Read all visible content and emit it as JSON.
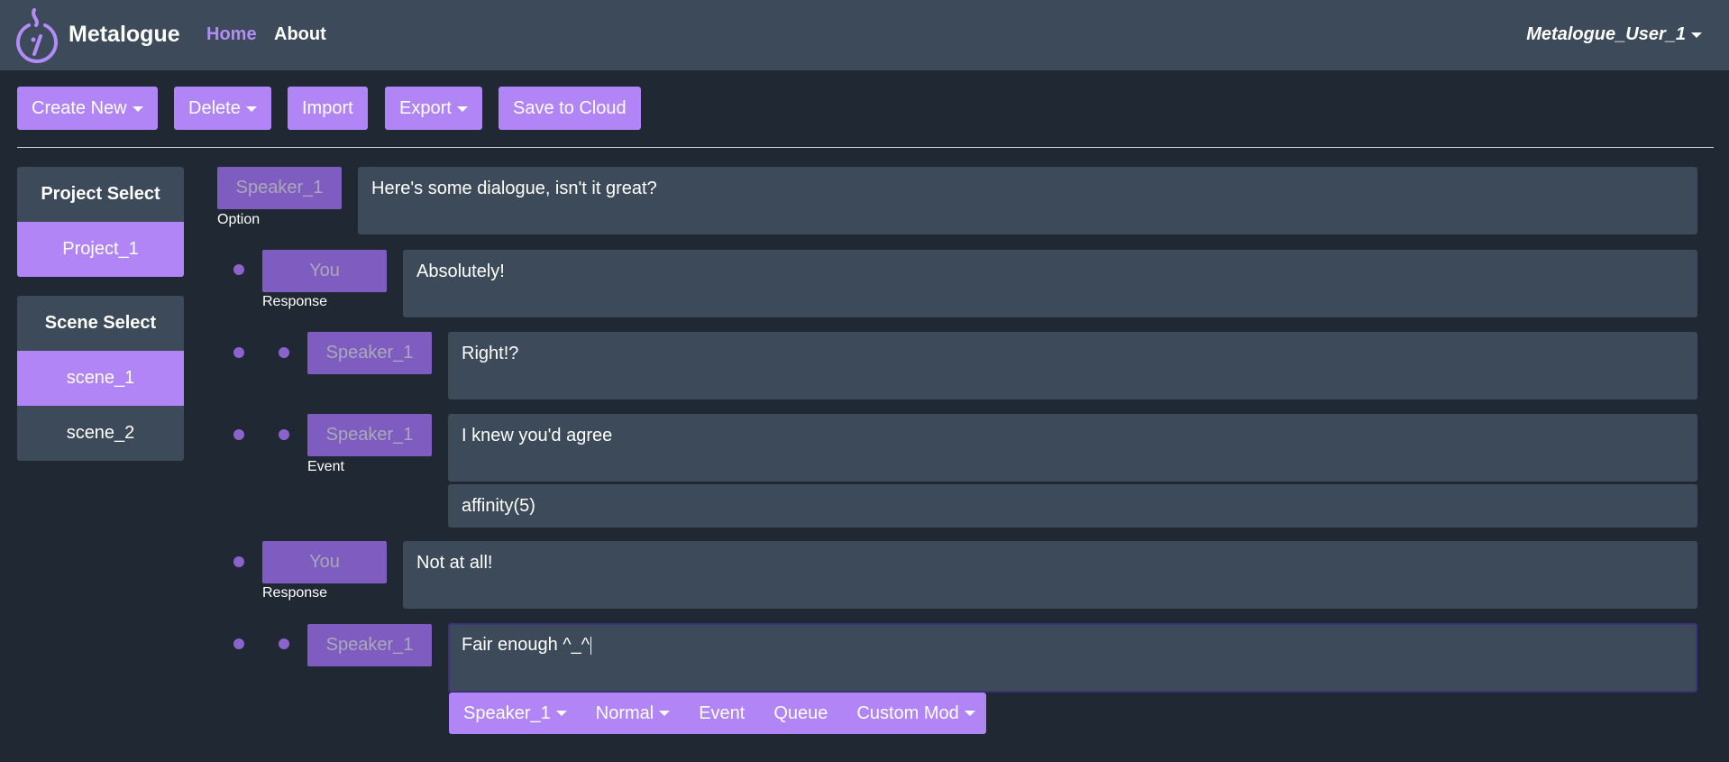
{
  "app": {
    "name": "Metalogue"
  },
  "nav": {
    "home": "Home",
    "about": "About",
    "user": "Metalogue_User_1"
  },
  "toolbar": {
    "create_new": "Create New",
    "delete": "Delete",
    "import": "Import",
    "export": "Export",
    "save_cloud": "Save to Cloud"
  },
  "sidebar": {
    "project_header": "Project Select",
    "projects": [
      "Project_1"
    ],
    "scene_header": "Scene Select",
    "scenes": [
      "scene_1",
      "scene_2"
    ]
  },
  "dialogue": [
    {
      "speaker": "Speaker_1",
      "role": "Option",
      "text": "Here's some dialogue, isn't it great?"
    },
    {
      "speaker": "You",
      "role": "Response",
      "text": "Absolutely!"
    },
    {
      "speaker": "Speaker_1",
      "role": "",
      "text": "Right!?"
    },
    {
      "speaker": "Speaker_1",
      "role": "Event",
      "text": "I knew you'd agree",
      "event": "affinity(5)"
    },
    {
      "speaker": "You",
      "role": "Response",
      "text": "Not at all!"
    },
    {
      "speaker": "Speaker_1",
      "role": "",
      "text": "Fair enough ^_^"
    }
  ],
  "editor_bar": {
    "speaker": "Speaker_1",
    "mode": "Normal",
    "event": "Event",
    "queue": "Queue",
    "custom_mod": "Custom Mod"
  },
  "colors": {
    "accent": "#b185f6",
    "speaker_button": "#7e5cc0",
    "navbar": "#3c4a59",
    "background": "#1f2833"
  }
}
